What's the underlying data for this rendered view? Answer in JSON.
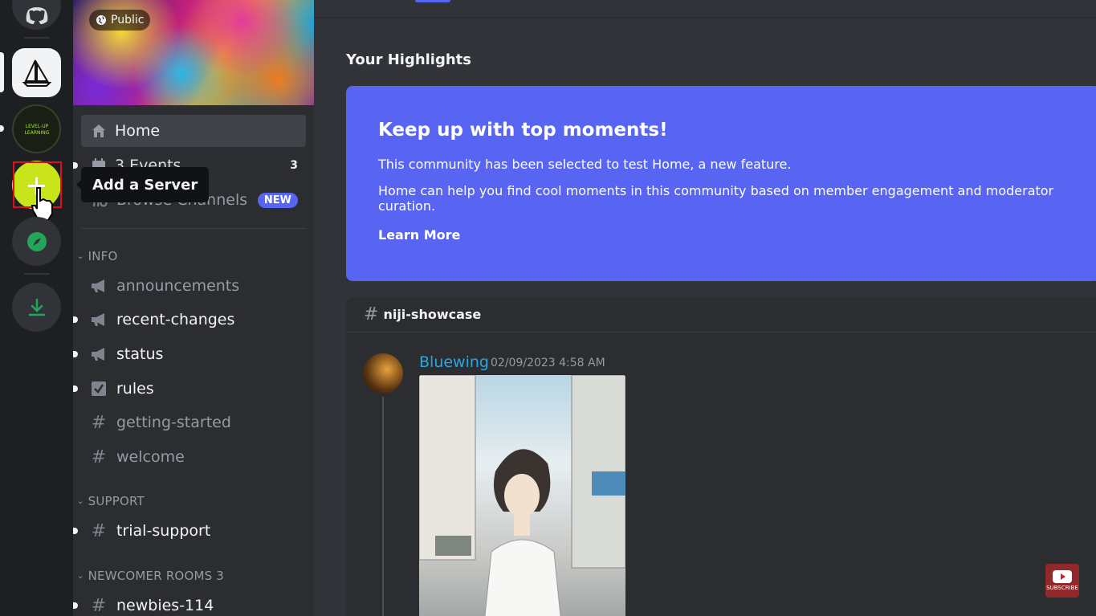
{
  "servers": {
    "add_server_tooltip": "Add a Server"
  },
  "sidebar": {
    "visibility_tag": "Public",
    "home_label": "Home",
    "events_label": "3 Events",
    "events_count": "3",
    "browse_label": "Browse Channels",
    "new_badge": "NEW",
    "categories": [
      {
        "name": "INFO",
        "channels": [
          {
            "name": "announcements",
            "icon": "megaphone-icon",
            "unread": false
          },
          {
            "name": "recent-changes",
            "icon": "megaphone-icon",
            "unread": true
          },
          {
            "name": "status",
            "icon": "megaphone-icon",
            "unread": true
          },
          {
            "name": "rules",
            "icon": "checkbox-icon",
            "unread": true
          },
          {
            "name": "getting-started",
            "icon": "hash-icon",
            "unread": false
          },
          {
            "name": "welcome",
            "icon": "hash-icon",
            "unread": false
          }
        ]
      },
      {
        "name": "SUPPORT",
        "channels": [
          {
            "name": "trial-support",
            "icon": "hash-icon",
            "unread": true
          }
        ]
      },
      {
        "name": "NEWCOMER ROOMS 3",
        "channels": [
          {
            "name": "newbies-114",
            "icon": "thread-hash-icon",
            "unread": true
          }
        ]
      }
    ]
  },
  "main": {
    "highlights_title": "Your Highlights",
    "card": {
      "heading": "Keep up with top moments!",
      "line1": "This community has been selected to test Home, a new feature.",
      "line2": "Home can help you find cool moments in this community based on member engagement and moderator curation.",
      "learn_more": "Learn More",
      "color": "#5865f2"
    },
    "post": {
      "channel": "niji-showcase",
      "author": "Bluewing",
      "timestamp": "02/09/2023 4:58 AM"
    }
  },
  "watermark": {
    "label": "SUBSCRIBE"
  }
}
